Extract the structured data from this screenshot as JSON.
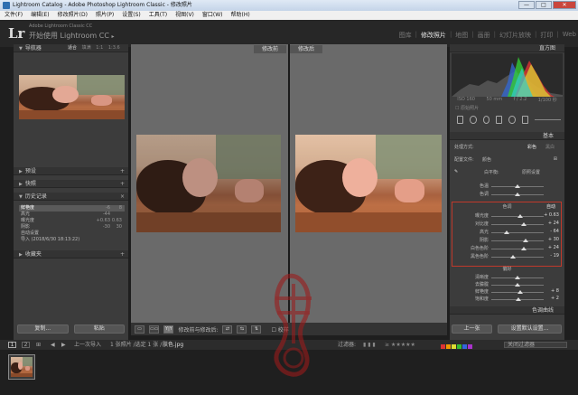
{
  "window": {
    "title": "Lightroom Catalog - Adobe Photoshop Lightroom Classic - 修改照片",
    "buttons": [
      "—",
      "□",
      "✕"
    ]
  },
  "menu": [
    "文件(F)",
    "编辑(E)",
    "修改照片(D)",
    "照片(P)",
    "设置(S)",
    "工具(T)",
    "视图(V)",
    "窗口(W)",
    "帮助(H)"
  ],
  "identity": {
    "logo": "Lr",
    "catalog": "Adobe Lightroom Classic CC",
    "text": "开始使用 Lightroom CC",
    "arrow": "▸"
  },
  "modules": [
    "图库",
    "修改照片",
    "地图",
    "画册",
    "幻灯片放映",
    "打印",
    "Web"
  ],
  "active_module": "修改照片",
  "left": {
    "navigator": {
      "title": "导航器",
      "options": [
        "适合",
        "填满",
        "1:1",
        "1:3.6"
      ]
    },
    "presets": "预设",
    "snapshots": "快照",
    "history": {
      "title": "历史记录",
      "close": "×",
      "rows": [
        {
          "name": "鲜艳度",
          "v1": "-6",
          "v2": "8"
        },
        {
          "name": "高光",
          "v1": "-44",
          "v2": ""
        },
        {
          "name": "曝光度",
          "v1": "+0.63",
          "v2": "0.63"
        },
        {
          "name": "阴影",
          "v1": "-30",
          "v2": "30"
        },
        {
          "name": "自动设置",
          "v1": "",
          "v2": ""
        },
        {
          "name": "导入 (2018/6/30 18:13:22)",
          "v1": "",
          "v2": ""
        }
      ]
    },
    "collections": "收藏夹",
    "buttons": {
      "copy": "复制...",
      "paste": "粘贴"
    }
  },
  "center": {
    "before_label": "修改前",
    "after_label": "修改后",
    "toolbar": {
      "view_btns": [
        "▭",
        "▭▭",
        "Y|Y"
      ],
      "label": "修改前与修改后:",
      "soft_proof": "校样"
    }
  },
  "right": {
    "histogram_title": "直方图",
    "hist_info": [
      "ISO 160",
      "50 mm",
      "f / 2.2",
      "1/100 秒"
    ],
    "original_photo": "原始照片",
    "basic": {
      "title": "基本",
      "treatment": "处理方式:",
      "color": "彩色",
      "bw": "黑白",
      "profile": "配置文件:",
      "profile_value": "颜色",
      "wb_label": "白平衡:",
      "wb_value": "原照设置",
      "temp": "色温",
      "tint": "色调",
      "tone": "色调",
      "auto": "自动",
      "presence": "偏好"
    },
    "tone_sliders": [
      {
        "label": "曝光度",
        "value": "+ 0.63",
        "pos": 0.55
      },
      {
        "label": "对比度",
        "value": "+ 24",
        "pos": 0.62
      },
      {
        "label": "高光",
        "value": "- 64",
        "pos": 0.3
      },
      {
        "label": "阴影",
        "value": "+ 30",
        "pos": 0.65
      },
      {
        "label": "白色色阶",
        "value": "+ 24",
        "pos": 0.62
      },
      {
        "label": "黑色色阶",
        "value": "- 19",
        "pos": 0.42
      }
    ],
    "wb_sliders": [
      {
        "label": "色温",
        "value": "",
        "pos": 0.5
      },
      {
        "label": "色调",
        "value": "",
        "pos": 0.5
      }
    ],
    "presence_sliders": [
      {
        "label": "清晰度",
        "value": "",
        "pos": 0.5
      },
      {
        "label": "去朦胧",
        "value": "",
        "pos": 0.5
      },
      {
        "label": "鲜艳度",
        "value": "+ 8",
        "pos": 0.55
      },
      {
        "label": "饱和度",
        "value": "+ 2",
        "pos": 0.52
      }
    ],
    "tone_curve": "色调曲线",
    "buttons": {
      "previous": "上一张",
      "reset": "设置默认设置..."
    }
  },
  "filmstrip": {
    "pages": [
      "1",
      "2"
    ],
    "path": "上一次导入",
    "info": "1 张照片 /选定 1 张 /",
    "filename": "肤色.jpg",
    "filter_label": "过滤器:",
    "filter_value": "关闭过滤器",
    "colors": [
      "#d33",
      "#e90",
      "#dd3",
      "#3b3",
      "#36d",
      "#a3c"
    ]
  },
  "watermark": "紫"
}
